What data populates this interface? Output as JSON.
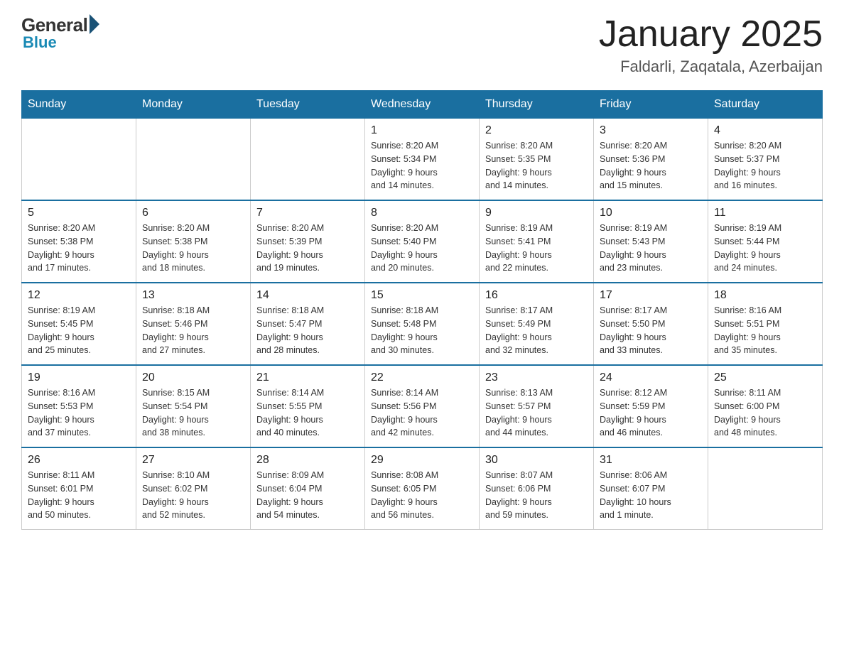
{
  "header": {
    "logo": {
      "general": "General",
      "blue": "Blue"
    },
    "title": "January 2025",
    "location": "Faldarli, Zaqatala, Azerbaijan"
  },
  "days_of_week": [
    "Sunday",
    "Monday",
    "Tuesday",
    "Wednesday",
    "Thursday",
    "Friday",
    "Saturday"
  ],
  "weeks": [
    [
      {
        "day": "",
        "info": ""
      },
      {
        "day": "",
        "info": ""
      },
      {
        "day": "",
        "info": ""
      },
      {
        "day": "1",
        "info": "Sunrise: 8:20 AM\nSunset: 5:34 PM\nDaylight: 9 hours\nand 14 minutes."
      },
      {
        "day": "2",
        "info": "Sunrise: 8:20 AM\nSunset: 5:35 PM\nDaylight: 9 hours\nand 14 minutes."
      },
      {
        "day": "3",
        "info": "Sunrise: 8:20 AM\nSunset: 5:36 PM\nDaylight: 9 hours\nand 15 minutes."
      },
      {
        "day": "4",
        "info": "Sunrise: 8:20 AM\nSunset: 5:37 PM\nDaylight: 9 hours\nand 16 minutes."
      }
    ],
    [
      {
        "day": "5",
        "info": "Sunrise: 8:20 AM\nSunset: 5:38 PM\nDaylight: 9 hours\nand 17 minutes."
      },
      {
        "day": "6",
        "info": "Sunrise: 8:20 AM\nSunset: 5:38 PM\nDaylight: 9 hours\nand 18 minutes."
      },
      {
        "day": "7",
        "info": "Sunrise: 8:20 AM\nSunset: 5:39 PM\nDaylight: 9 hours\nand 19 minutes."
      },
      {
        "day": "8",
        "info": "Sunrise: 8:20 AM\nSunset: 5:40 PM\nDaylight: 9 hours\nand 20 minutes."
      },
      {
        "day": "9",
        "info": "Sunrise: 8:19 AM\nSunset: 5:41 PM\nDaylight: 9 hours\nand 22 minutes."
      },
      {
        "day": "10",
        "info": "Sunrise: 8:19 AM\nSunset: 5:43 PM\nDaylight: 9 hours\nand 23 minutes."
      },
      {
        "day": "11",
        "info": "Sunrise: 8:19 AM\nSunset: 5:44 PM\nDaylight: 9 hours\nand 24 minutes."
      }
    ],
    [
      {
        "day": "12",
        "info": "Sunrise: 8:19 AM\nSunset: 5:45 PM\nDaylight: 9 hours\nand 25 minutes."
      },
      {
        "day": "13",
        "info": "Sunrise: 8:18 AM\nSunset: 5:46 PM\nDaylight: 9 hours\nand 27 minutes."
      },
      {
        "day": "14",
        "info": "Sunrise: 8:18 AM\nSunset: 5:47 PM\nDaylight: 9 hours\nand 28 minutes."
      },
      {
        "day": "15",
        "info": "Sunrise: 8:18 AM\nSunset: 5:48 PM\nDaylight: 9 hours\nand 30 minutes."
      },
      {
        "day": "16",
        "info": "Sunrise: 8:17 AM\nSunset: 5:49 PM\nDaylight: 9 hours\nand 32 minutes."
      },
      {
        "day": "17",
        "info": "Sunrise: 8:17 AM\nSunset: 5:50 PM\nDaylight: 9 hours\nand 33 minutes."
      },
      {
        "day": "18",
        "info": "Sunrise: 8:16 AM\nSunset: 5:51 PM\nDaylight: 9 hours\nand 35 minutes."
      }
    ],
    [
      {
        "day": "19",
        "info": "Sunrise: 8:16 AM\nSunset: 5:53 PM\nDaylight: 9 hours\nand 37 minutes."
      },
      {
        "day": "20",
        "info": "Sunrise: 8:15 AM\nSunset: 5:54 PM\nDaylight: 9 hours\nand 38 minutes."
      },
      {
        "day": "21",
        "info": "Sunrise: 8:14 AM\nSunset: 5:55 PM\nDaylight: 9 hours\nand 40 minutes."
      },
      {
        "day": "22",
        "info": "Sunrise: 8:14 AM\nSunset: 5:56 PM\nDaylight: 9 hours\nand 42 minutes."
      },
      {
        "day": "23",
        "info": "Sunrise: 8:13 AM\nSunset: 5:57 PM\nDaylight: 9 hours\nand 44 minutes."
      },
      {
        "day": "24",
        "info": "Sunrise: 8:12 AM\nSunset: 5:59 PM\nDaylight: 9 hours\nand 46 minutes."
      },
      {
        "day": "25",
        "info": "Sunrise: 8:11 AM\nSunset: 6:00 PM\nDaylight: 9 hours\nand 48 minutes."
      }
    ],
    [
      {
        "day": "26",
        "info": "Sunrise: 8:11 AM\nSunset: 6:01 PM\nDaylight: 9 hours\nand 50 minutes."
      },
      {
        "day": "27",
        "info": "Sunrise: 8:10 AM\nSunset: 6:02 PM\nDaylight: 9 hours\nand 52 minutes."
      },
      {
        "day": "28",
        "info": "Sunrise: 8:09 AM\nSunset: 6:04 PM\nDaylight: 9 hours\nand 54 minutes."
      },
      {
        "day": "29",
        "info": "Sunrise: 8:08 AM\nSunset: 6:05 PM\nDaylight: 9 hours\nand 56 minutes."
      },
      {
        "day": "30",
        "info": "Sunrise: 8:07 AM\nSunset: 6:06 PM\nDaylight: 9 hours\nand 59 minutes."
      },
      {
        "day": "31",
        "info": "Sunrise: 8:06 AM\nSunset: 6:07 PM\nDaylight: 10 hours\nand 1 minute."
      },
      {
        "day": "",
        "info": ""
      }
    ]
  ]
}
